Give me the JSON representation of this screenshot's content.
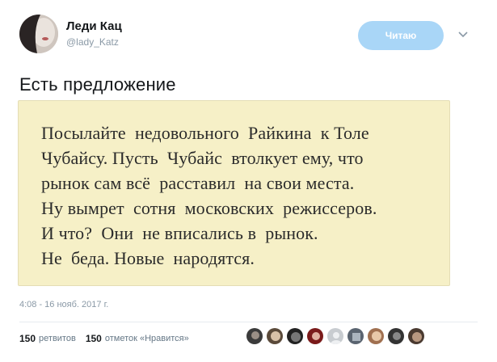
{
  "user": {
    "display_name": "Леди Кац",
    "handle": "@lady_Katz"
  },
  "follow": {
    "label": "Читаю"
  },
  "tweet": {
    "text": "Есть предложение",
    "timestamp": "4:08 - 16 нояб. 2017 г."
  },
  "image_text": {
    "lines": [
      "Посылайте  недовольного  Райкина  к Толе",
      "Чубайсу. Пусть  Чубайс  втолкует ему, что",
      "рынок сам всё  расставил  на свои места.",
      "Ну вымрет  сотня  московских  режиссеров.",
      "И что?  Они  не вписались в  рынок.",
      "Не  беда. Новые  народятся."
    ]
  },
  "stats": {
    "retweets_count": "150",
    "retweets_label": "ретвитов",
    "likes_count": "150",
    "likes_label": "отметок «Нравится»"
  },
  "colors": {
    "follow_bg": "#a9d6f7",
    "image_bg": "#f6f0c7",
    "muted": "#8a99a6"
  },
  "icons": {
    "caret": "chevron-down-icon"
  }
}
